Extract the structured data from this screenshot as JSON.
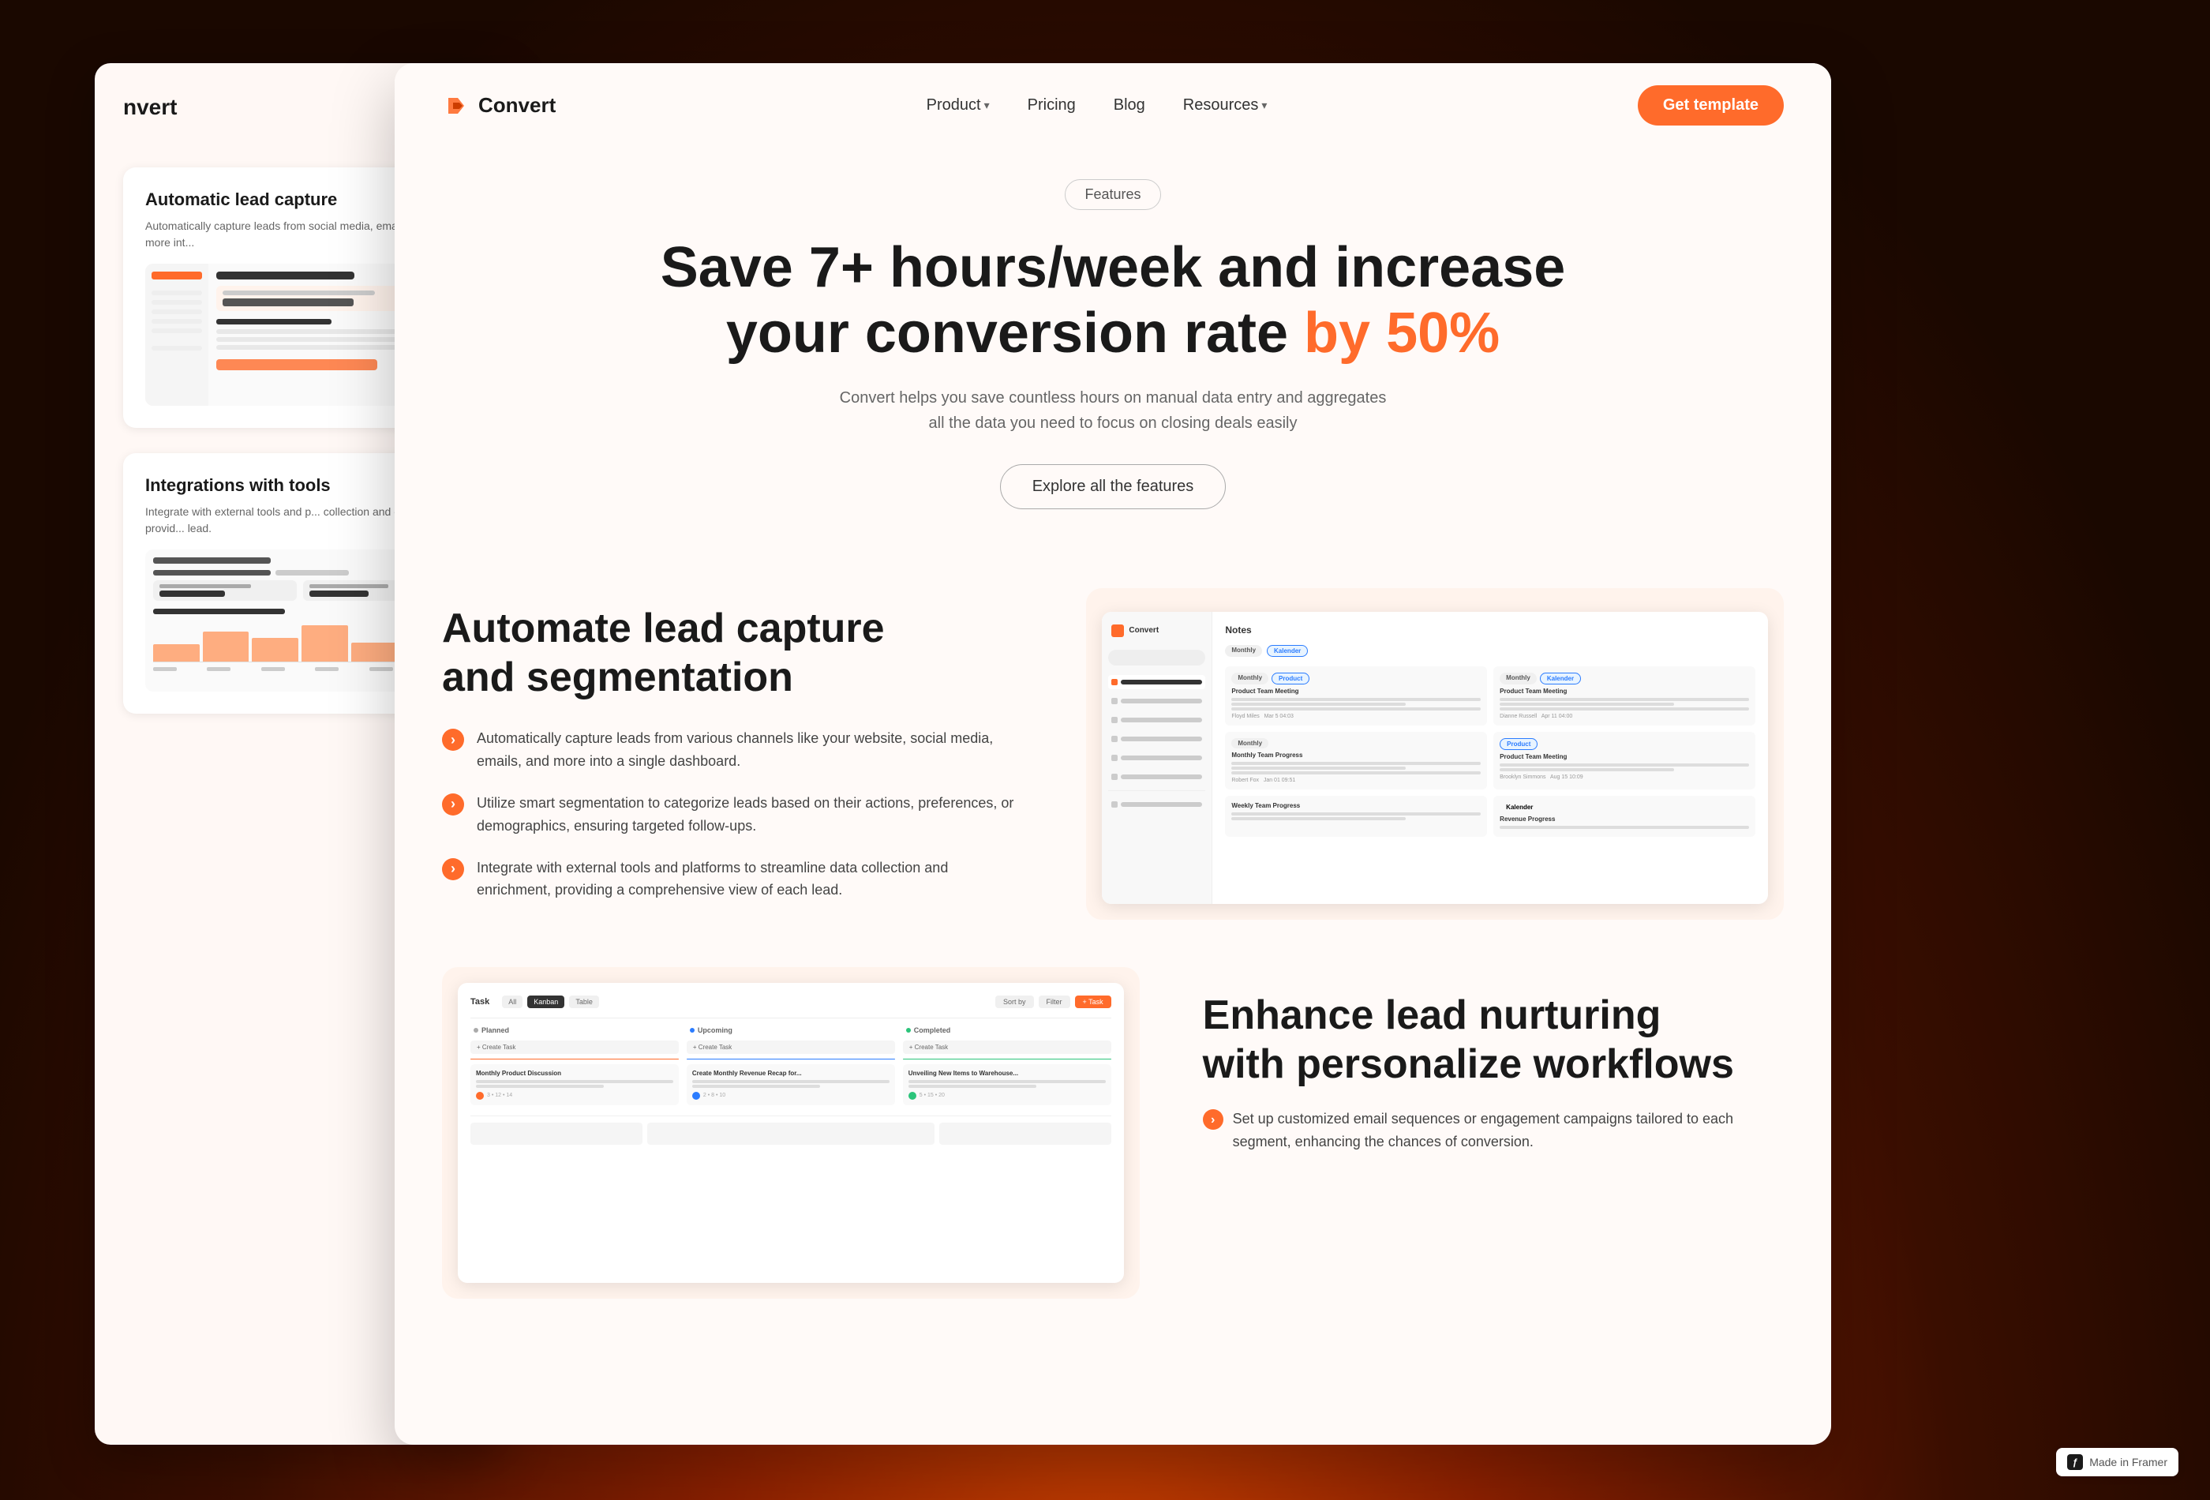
{
  "background": {
    "color": "#1a0800"
  },
  "leftPanel": {
    "logo": "nvert",
    "card1": {
      "title": "Automatic lead capture",
      "description": "Automatically capture leads from social media, emails, and more int..."
    },
    "card2": {
      "title": "Integrations with tools",
      "description": "Integrate with external tools and p... collection and enrichment, provid... lead."
    }
  },
  "navbar": {
    "logo": "Convert",
    "links": [
      {
        "label": "Product",
        "hasChevron": true
      },
      {
        "label": "Pricing",
        "hasChevron": false
      },
      {
        "label": "Blog",
        "hasChevron": false
      },
      {
        "label": "Resources",
        "hasChevron": true
      }
    ],
    "cta": "Get template"
  },
  "hero": {
    "badge": "Features",
    "title_line1": "Save 7+ hours/week and increase",
    "title_line2_pre": "your conversion rate ",
    "title_line2_highlight": "by 50%",
    "subtitle": "Convert helps you save countless hours on manual data entry and aggregates all the data you need to focus on closing deals easily",
    "cta": "Explore all the features"
  },
  "feature1": {
    "title_line1": "Automate lead capture",
    "title_line2": "and segmentation",
    "points": [
      "Automatically capture leads from various channels like your website, social media, emails, and more into a single dashboard.",
      "Utilize smart segmentation to categorize leads based on their actions, preferences, or demographics, ensuring targeted follow-ups.",
      "Integrate with external tools and platforms to streamline data collection and enrichment, providing a comprehensive view of each lead."
    ]
  },
  "feature2": {
    "title_line1": "Enhance lead nurturing",
    "title_line2": "with personalize workflows",
    "point": "Set up customized email sequences or engagement campaigns tailored to each segment, enhancing the chances of conversion."
  },
  "framer": {
    "label": "Made in Framer"
  }
}
